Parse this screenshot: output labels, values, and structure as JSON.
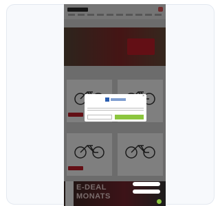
{
  "hero": {
    "text": ""
  },
  "sections": [
    {
      "title": ""
    },
    {
      "title": ""
    }
  ],
  "banner": {
    "text": "E-DEAL\nMONATS"
  },
  "modal": {
    "title": "",
    "deny_label": "",
    "accept_label": ""
  },
  "floating": {
    "pill1": "",
    "pill2": ""
  },
  "colors": {
    "accent_red": "#c61f2a",
    "accent_green": "#8cc63f",
    "overlay": "rgba(0,0,0,0.5)"
  }
}
